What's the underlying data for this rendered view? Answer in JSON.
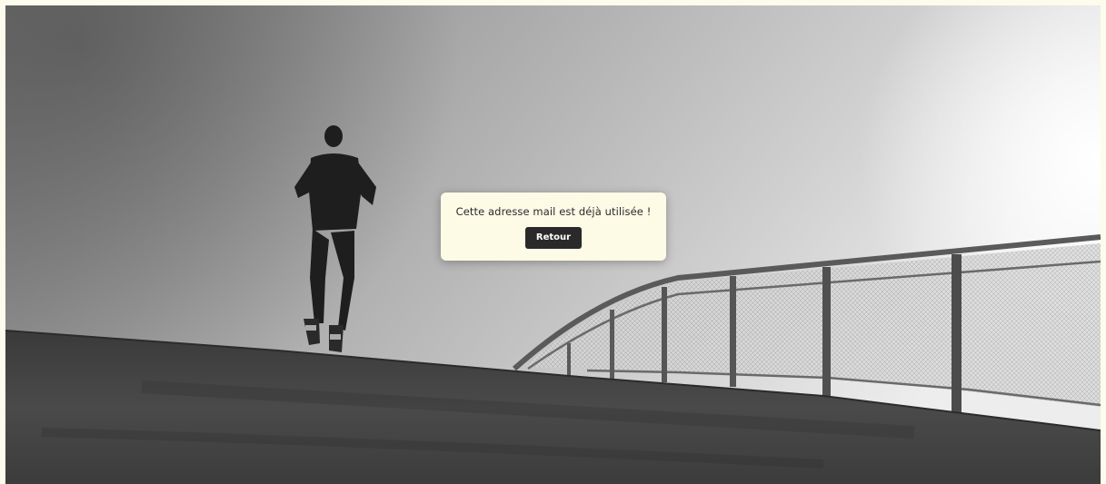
{
  "background": {
    "image_subject": "runner-on-ramp-photo"
  },
  "alert": {
    "message": "Cette adresse mail est déjà utilisée !",
    "button_label": "Retour"
  },
  "colors": {
    "page_background": "#fdfbec",
    "modal_background": "#fdfae6",
    "button_background": "#2a2a2a",
    "button_text": "#ffffff"
  }
}
